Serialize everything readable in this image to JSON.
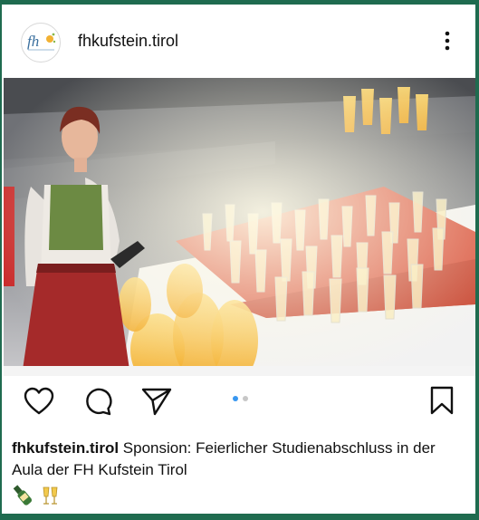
{
  "post": {
    "username": "fhkufstein.tirol",
    "avatar_text": "fh",
    "more_icon": "vertical-ellipsis-icon",
    "actions": {
      "like_icon": "heart-icon",
      "comment_icon": "comment-bubble-icon",
      "share_icon": "paper-plane-icon",
      "save_icon": "bookmark-icon"
    },
    "carousel": {
      "total": 2,
      "active": 1,
      "active_color": "#3897f0",
      "inactive_color": "#c7c7c7"
    },
    "caption": {
      "username": "fhkufstein.tirol",
      "text": "Sponsion: Feierlicher Studienabschluss in der Aula der FH Kufstein Tirol",
      "emoji_line": "🍾🥂"
    }
  },
  "colors": {
    "frame": "#1f6b4f",
    "text": "#111111"
  }
}
